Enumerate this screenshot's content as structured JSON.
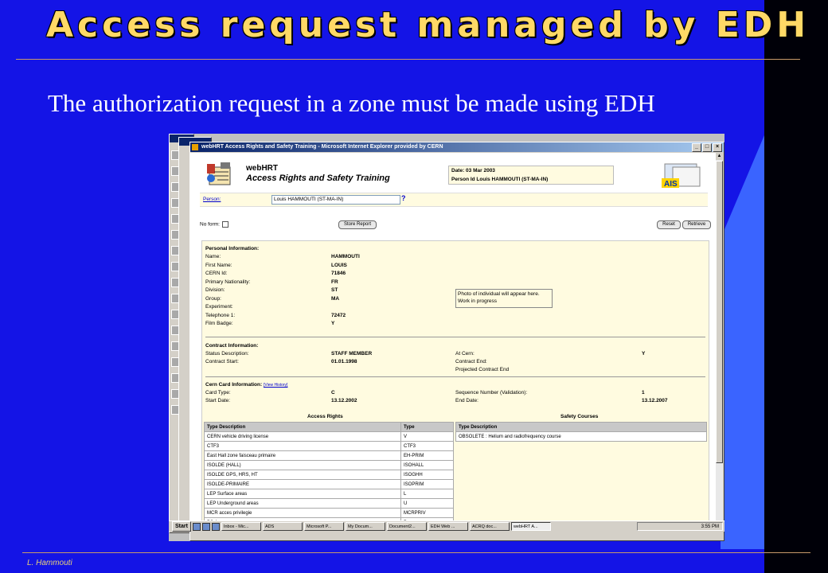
{
  "slide": {
    "title": "Access request managed by EDH",
    "subtitle": "The authorization request in a zone must be made using EDH",
    "footer": "L. Hammouti"
  },
  "browser": {
    "title": "webHRT Access Rights and Safety Training - Microsoft Internet Explorer provided by CERN",
    "controls": [
      "_",
      "□",
      "×"
    ]
  },
  "app": {
    "name": "webHRT",
    "subtitle": "Access Rights and Safety Training",
    "date_line": "Date: 03 Mar 2003",
    "person_id_line": "Person Id Louis HAMMOUTI (ST-MA-IN)",
    "logo_text": "AIS",
    "person_label": "Person:",
    "person_value": "Louis HAMMOUTI (ST-MA-IN)",
    "help": "?",
    "no_form_label": "No form:",
    "store_report": "Store Report",
    "reset": "Reset",
    "retrieve": "Retrieve"
  },
  "personal": {
    "heading": "Personal Information:",
    "labels": [
      "Name:",
      "First Name:",
      "CERN Id:",
      "Primary Nationality:",
      "Division:",
      "Group:",
      "Experiment:",
      "Telephone 1:",
      "Film Badge:"
    ],
    "values": [
      "HAMMOUTI",
      "LOUIS",
      "71846",
      "FR",
      "ST",
      "MA",
      "",
      "72472",
      "Y"
    ],
    "photo_line1": "Photo of individual will appear here.",
    "photo_line2": "Work in progress"
  },
  "contract": {
    "heading": "Contract Information:",
    "status_label": "Status Description:",
    "status_value": "STAFF MEMBER",
    "start_label": "Contract Start:",
    "start_value": "01.01.1998",
    "at_cern_label": "At Cern:",
    "at_cern_value": "Y",
    "end_label": "Contract End:",
    "projected_end_label": "Projected Contract End"
  },
  "card": {
    "heading": "Cern Card Information:",
    "history_link": "[View History]",
    "type_label": "Card Type:",
    "type_value": "C",
    "start_label": "Start Date:",
    "start_value": "13.12.2002",
    "seq_label": "Sequence Number (Validation):",
    "seq_value": "1",
    "end_label": "End Date:",
    "end_value": "13.12.2007"
  },
  "access_rights": {
    "title": "Access Rights",
    "headers": [
      "Type Description",
      "Type"
    ],
    "rows": [
      [
        "CERN vehicle driving license",
        "V"
      ],
      [
        "CTF3",
        "CTF3"
      ],
      [
        "East Hall zone faisceau primaire",
        "EH-PRIM"
      ],
      [
        "ISOLDE (HALL)",
        "ISOHALL"
      ],
      [
        "ISOLDE GPS, HRS, HT",
        "ISOGHH"
      ],
      [
        "ISOLDE-PRIMAIRE",
        "ISOPRIM"
      ],
      [
        "LEP Surface areas",
        "L"
      ],
      [
        "LEP Underground areas",
        "U"
      ],
      [
        "MCR acces privilegie",
        "MCRPRIV"
      ],
      [
        "PS Areas",
        "P"
      ]
    ]
  },
  "safety_courses": {
    "title": "Safety Courses",
    "headers": [
      "Type Description"
    ],
    "rows": [
      [
        "OBSOLETE : Helium and radiofrequency course"
      ]
    ]
  },
  "taskbar": {
    "start": "Start",
    "tasks": [
      "Inbox - Mic...",
      "ADS",
      "Microsoft P...",
      "My Docum...",
      "Document2...",
      "EDH Web ...",
      "ACRQ doc...",
      "webHRT A..."
    ],
    "clock": "3:55 PM"
  },
  "colors": {
    "slide_bg": "#1414e6",
    "title": "#ffd966",
    "panel": "#fffbe0",
    "titlebar": "#0a246a"
  }
}
